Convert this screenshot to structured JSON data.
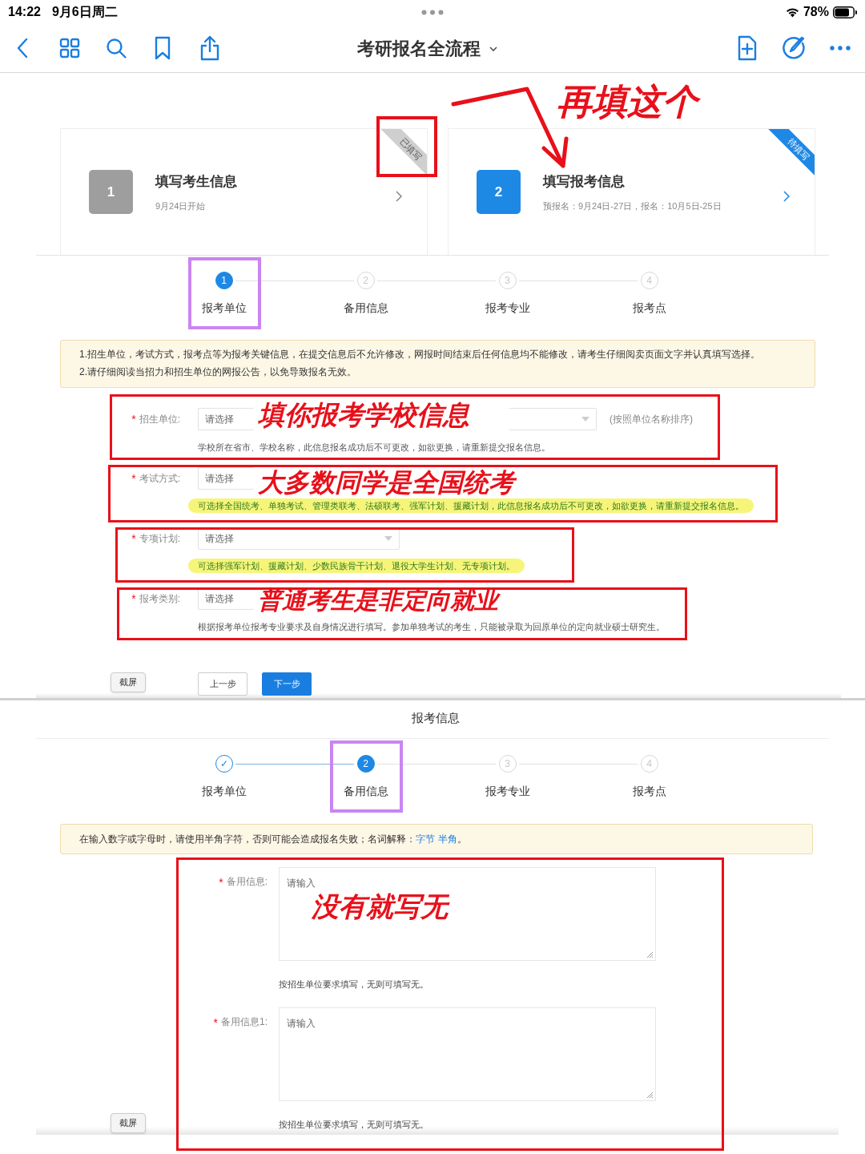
{
  "status_bar": {
    "time": "14:22",
    "date": "9月6日周二",
    "battery": "78%"
  },
  "toolbar": {
    "title": "考研报名全流程"
  },
  "screenshot_1": {
    "cards": [
      {
        "number": "1",
        "title": "填写考生信息",
        "subtitle": "9月24日开始",
        "ribbon": "已填写",
        "completed": true,
        "boxed": true
      },
      {
        "number": "2",
        "title": "填写报考信息",
        "subtitle": "预报名：9月24日-27日，报名：10月5日-25日",
        "ribbon": "待填写",
        "completed": false,
        "note": "再填这个"
      }
    ],
    "steps": [
      {
        "symbol": "1",
        "label": "报考单位",
        "current": true,
        "completed": false,
        "highlighted": true
      },
      {
        "symbol": "2",
        "label": "备用信息",
        "current": false,
        "completed": false
      },
      {
        "symbol": "3",
        "label": "报考专业",
        "current": false,
        "completed": false
      },
      {
        "symbol": "4",
        "label": "报考点",
        "current": false,
        "completed": false
      }
    ],
    "notice": [
      "1.招生单位，考试方式，报考点等为报考关键信息，在提交信息后不允许修改，网报时间结束后任何信息均不能修改，请考生仔细阅卖页面文字并认真填写选择。",
      "2.请仔细阅读当招力和招生单位的网报公告，以免导致报名无效。"
    ],
    "fields": [
      {
        "required_mark": "*",
        "label": "招生单位:",
        "placeholder": "请选择",
        "second_select": true,
        "side_note": "(按照单位名称排序)",
        "hint": "学校所在省市、学校名称，此信息报名成功后不可更改，如欲更换，请重新提交报名信息。",
        "hint_highlighted": false,
        "note": "填你报考学校信息"
      },
      {
        "required_mark": "*",
        "label": "考试方式:",
        "placeholder": "请选择",
        "hint": "可选择全国统考、单独考试、管理类联考、法硕联考、强军计划、援藏计划，此信息报名成功后不可更改，如欲更换，请重新提交报名信息。",
        "hint_highlighted": true,
        "note": "大多数同学是全国统考"
      },
      {
        "required_mark": "*",
        "label": "专项计划:",
        "placeholder": "请选择",
        "hint": "可选择强军计划、援藏计划、少数民族骨干计划、退役大学生计划、无专项计划。",
        "hint_highlighted": true
      },
      {
        "required_mark": "*",
        "label": "报考类别:",
        "placeholder": "请选择",
        "hint": "根据报考单位报考专业要求及自身情况进行填写。参加单独考试的考生，只能被录取为回原单位的定向就业硕士研究生。",
        "hint_highlighted": false,
        "note": "普通考生是非定向就业"
      }
    ],
    "buttons": [
      {
        "label": "上一步",
        "kind": "secondary"
      },
      {
        "label": "下一步",
        "kind": "primary"
      }
    ],
    "tag": "截屏"
  },
  "screenshot_2": {
    "heading": "报考信息",
    "steps": [
      {
        "symbol": "✓",
        "label": "报考单位",
        "current": false,
        "completed": true
      },
      {
        "symbol": "2",
        "label": "备用信息",
        "current": true,
        "completed": false,
        "highlighted": true
      },
      {
        "symbol": "3",
        "label": "报考专业",
        "current": false,
        "completed": false
      },
      {
        "symbol": "4",
        "label": "报考点",
        "current": false,
        "completed": false
      }
    ],
    "notice": {
      "text": "在输入数字或字母时，请使用半角字符，否则可能会造成报名失败；名词解释：",
      "links": [
        "字节",
        "半角"
      ],
      "end": "。"
    },
    "fields": [
      {
        "required_mark": "*",
        "label": "备用信息:",
        "placeholder": "请输入",
        "hint": "按招生单位要求填写，无则可填写无。",
        "note": "没有就写无"
      },
      {
        "required_mark": "*",
        "label": "备用信息1:",
        "placeholder": "请输入",
        "hint": "按招生单位要求填写，无则可填写无。"
      }
    ],
    "tag": "截屏"
  }
}
